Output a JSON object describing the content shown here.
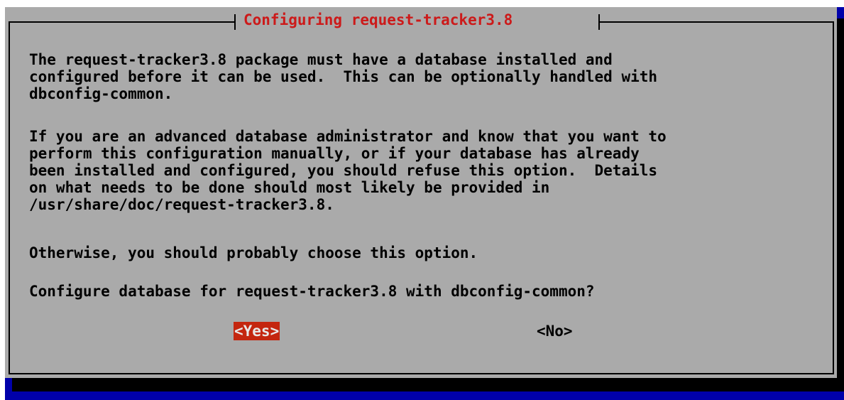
{
  "dialog": {
    "title": "Configuring request-tracker3.8",
    "paragraphs": [
      "The request-tracker3.8 package must have a database installed and\nconfigured before it can be used.  This can be optionally handled with\ndbconfig-common.",
      "If you are an advanced database administrator and know that you want to\nperform this configuration manually, or if your database has already\nbeen installed and configured, you should refuse this option.  Details\non what needs to be done should most likely be provided in\n/usr/share/doc/request-tracker3.8.",
      "Otherwise, you should probably choose this option."
    ],
    "question": "Configure database for request-tracker3.8 with dbconfig-common?",
    "buttons": {
      "yes_label": "<Yes>",
      "no_label": "<No>",
      "selected": "yes"
    }
  },
  "colors": {
    "screen_background": "#0000aa",
    "dialog_background": "#aaaaaa",
    "title_text": "#cc1a1a",
    "selected_button_background": "#c4260f",
    "body_text": "#000000"
  }
}
